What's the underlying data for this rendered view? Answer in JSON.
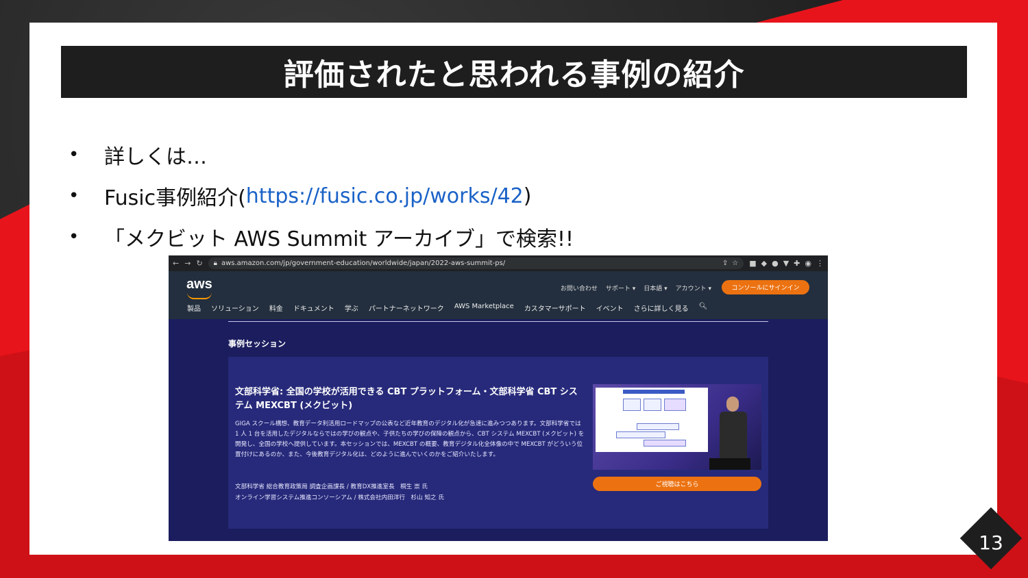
{
  "slide": {
    "title": "評価されたと思われる事例の紹介",
    "bullets": [
      {
        "text": "詳しくは…"
      },
      {
        "prefix": "Fusic事例紹介(",
        "link": "https://fusic.co.jp/works/42",
        "suffix": ")"
      },
      {
        "text": "「メクビット AWS Summit アーカイブ」で検索!!"
      }
    ],
    "page_number": "13",
    "colors": {
      "accent": "#e8141b",
      "title_bg": "#1e1e1e",
      "link": "#1a62c7"
    }
  },
  "screenshot": {
    "browser": {
      "url": "aws.amazon.com/jp/government-education/worldwide/japan/2022-aws-summit-ps/",
      "icons": [
        "back-icon",
        "forward-icon",
        "reload-icon",
        "lock-icon",
        "share-icon",
        "star-icon",
        "menu-icon"
      ]
    },
    "aws": {
      "logo": "aws",
      "top_links": [
        "お問い合わせ",
        "サポート ▾",
        "日本語 ▾",
        "アカウント ▾"
      ],
      "signin_label": "コンソールにサインイン",
      "nav": [
        "製品",
        "ソリューション",
        "料金",
        "ドキュメント",
        "学ぶ",
        "パートナーネットワーク",
        "AWS Marketplace",
        "カスタマーサポート",
        "イベント",
        "さらに詳しく見る"
      ]
    },
    "section_title": "事例セッション",
    "session": {
      "title": "文部科学省: 全国の学校が活用できる CBT プラットフォーム・文部科学省 CBT システム MEXCBT (メクビット)",
      "description": "GIGA スクール構想、教育データ利活用ロードマップの公表など近年教育のデジタル化が急速に進みつつあります。文部科学省では 1 人 1 台を活用したデジタルならではの学びの観点や、子供たちの学びの保障の観点から、CBT システム MEXCBT (メクビット) を開発し、全国の学校へ提供しています。本セッションでは、MEXCBT の概要、教育デジタル化全体像の中で MEXCBT がどういう位置付けにあるのか、また、今後教育デジタル化は、どのように進んでいくのかをご紹介いたします。",
      "speakers": [
        "文部科学省 総合教育政策局 調査企画課長 / 教育DX推進室長　桐生 崇 氏",
        "オンライン学習システム推進コンソーシアム / 株式会社内田洋行　杉山 知之 氏"
      ],
      "watch_label": "ご視聴はこちら"
    }
  }
}
